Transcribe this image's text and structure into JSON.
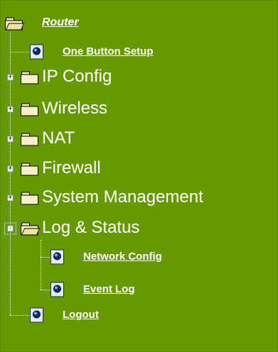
{
  "tree": {
    "root_label": "Router",
    "items": [
      {
        "label": "One Button Setup",
        "type": "link"
      },
      {
        "label": "IP Config",
        "type": "folder",
        "expander": "+"
      },
      {
        "label": "Wireless",
        "type": "folder",
        "expander": "+"
      },
      {
        "label": "NAT",
        "type": "folder",
        "expander": "+"
      },
      {
        "label": "Firewall",
        "type": "folder",
        "expander": "+"
      },
      {
        "label": "System Management",
        "type": "folder",
        "expander": "+"
      },
      {
        "label": "Log & Status",
        "type": "folder",
        "expander": "-",
        "children": [
          {
            "label": "Network Config",
            "type": "link"
          },
          {
            "label": "Event Log",
            "type": "link"
          }
        ]
      },
      {
        "label": "Logout",
        "type": "link"
      }
    ]
  },
  "colors": {
    "background": "#669900",
    "text": "#ffffff"
  }
}
